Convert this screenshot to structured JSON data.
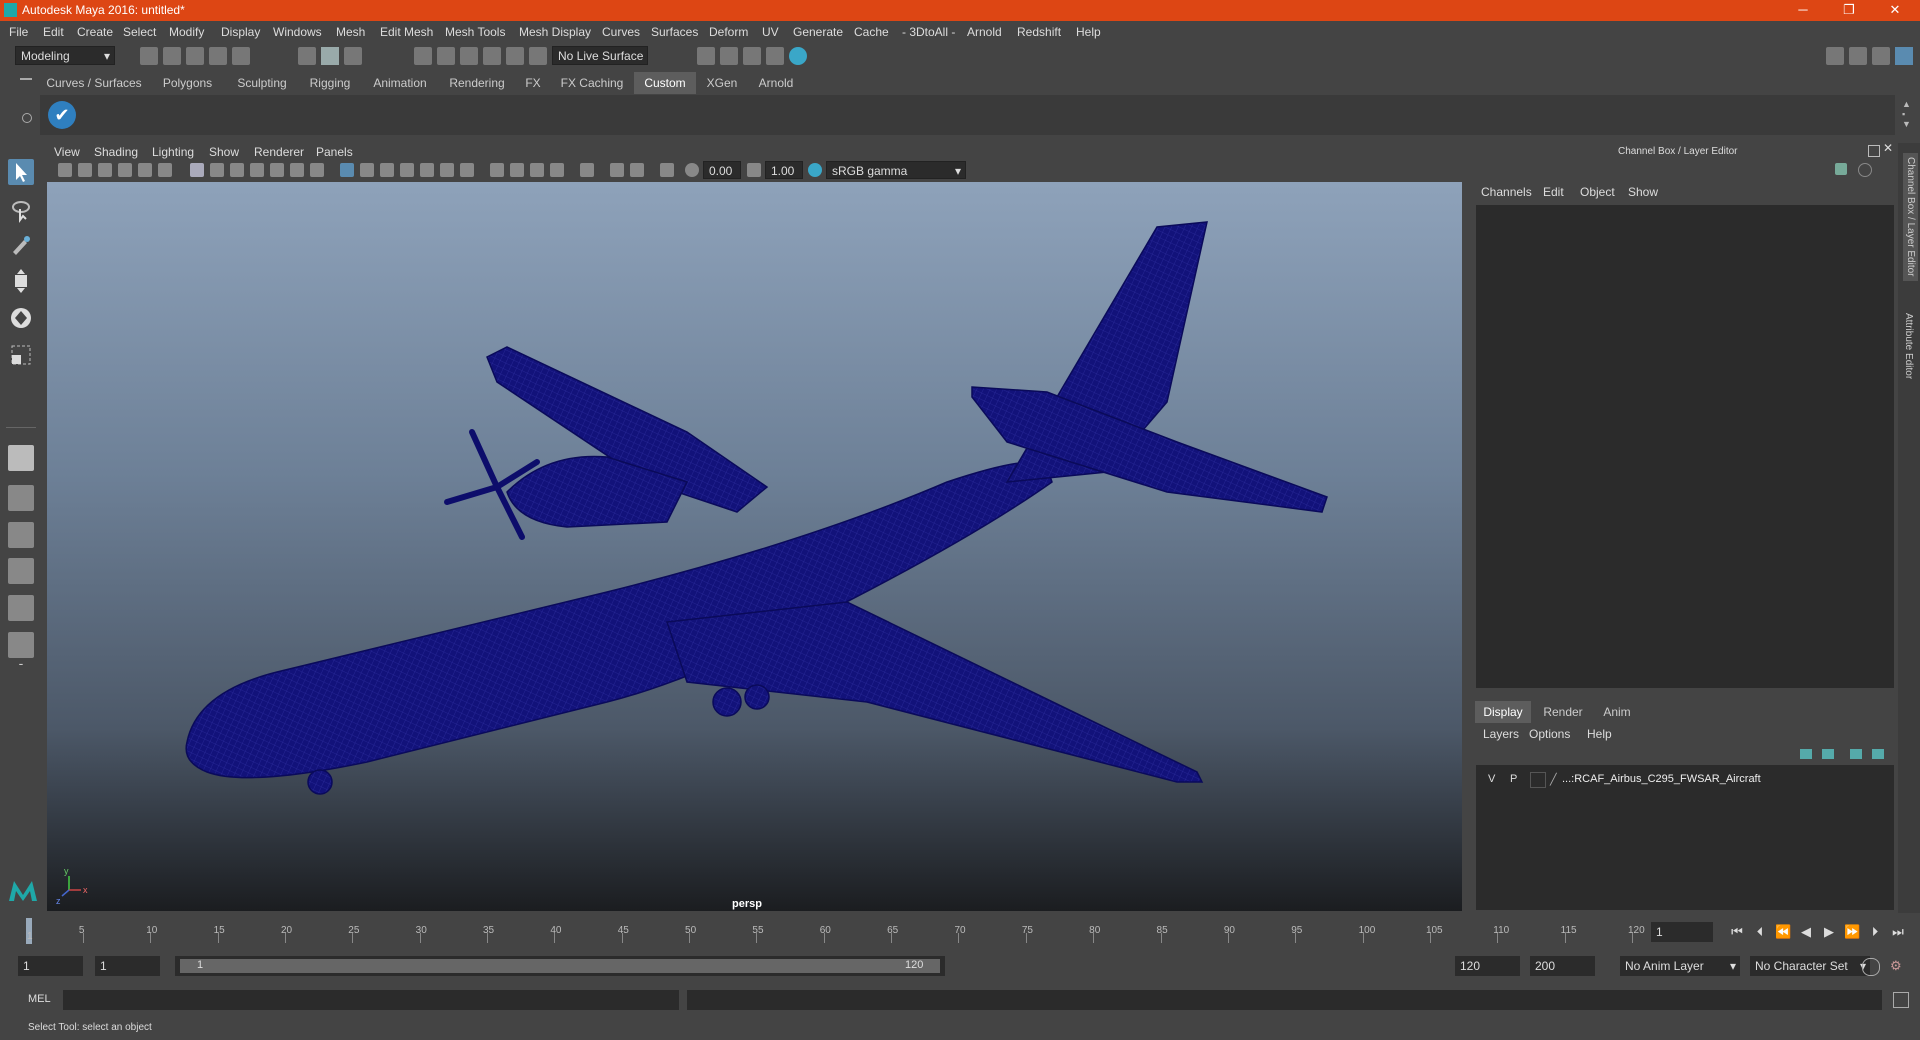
{
  "window": {
    "title": "Autodesk Maya 2016: untitled*",
    "minimize": "─",
    "maximize": "❐",
    "close": "✕"
  },
  "menubar": [
    "File",
    "Edit",
    "Create",
    "Select",
    "Modify",
    "Display",
    "Windows",
    "Mesh",
    "Edit Mesh",
    "Mesh Tools",
    "Mesh Display",
    "Curves",
    "Surfaces",
    "Deform",
    "UV",
    "Generate",
    "Cache",
    "- 3DtoAll -",
    "Arnold",
    "Redshift",
    "Help"
  ],
  "status": {
    "mode": "Modeling",
    "live_surface": "No Live Surface"
  },
  "shelf_tabs": [
    "Curves / Surfaces",
    "Polygons",
    "Sculpting",
    "Rigging",
    "Animation",
    "Rendering",
    "FX",
    "FX Caching",
    "Custom",
    "XGen",
    "Arnold"
  ],
  "shelf_active": "Custom",
  "viewport": {
    "menus": [
      "View",
      "Shading",
      "Lighting",
      "Show",
      "Renderer",
      "Panels"
    ],
    "exposure": "0.00",
    "gamma": "1.00",
    "color_space": "sRGB gamma",
    "camera_label": "persp",
    "axis_x": "x",
    "axis_y": "y",
    "axis_z": "z"
  },
  "channel_box": {
    "title": "Channel Box / Layer Editor",
    "menus": [
      "Channels",
      "Edit",
      "Object",
      "Show"
    ],
    "layer_tabs": [
      "Display",
      "Render",
      "Anim"
    ],
    "layer_active": "Display",
    "layer_menus": [
      "Layers",
      "Options",
      "Help"
    ],
    "layer": {
      "v": "V",
      "p": "P",
      "name": "...:RCAF_Airbus_C295_FWSAR_Aircraft"
    }
  },
  "side_tabs": [
    "Channel Box / Layer Editor",
    "Attribute Editor"
  ],
  "timeline": {
    "ticks": [
      "5",
      "10",
      "15",
      "20",
      "25",
      "30",
      "35",
      "40",
      "45",
      "50",
      "55",
      "60",
      "65",
      "70",
      "75",
      "80",
      "85",
      "90",
      "95",
      "100",
      "105",
      "110",
      "115",
      "120"
    ],
    "current_marker": "1",
    "current_frame": "1"
  },
  "range": {
    "start": "1",
    "playback_start": "1",
    "slider_start": "1",
    "slider_end": "120",
    "playback_end": "120",
    "end": "200",
    "anim_layer": "No Anim Layer",
    "character_set": "No Character Set"
  },
  "command": {
    "label": "MEL"
  },
  "help_line": "Select Tool: select an object",
  "colors": {
    "title_bar": "#dd4614",
    "wire": "#0d0d6b",
    "accent": "#5a8bb0"
  }
}
